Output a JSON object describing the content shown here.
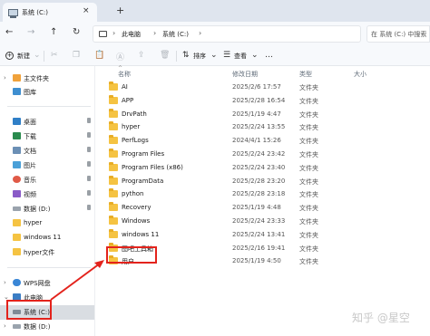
{
  "window": {
    "tab_title": "系统 (C:)",
    "tab_close": "×",
    "tab_add": "+"
  },
  "address": {
    "crumbs": [
      "此电脑",
      "系统 (C:)"
    ],
    "search_placeholder": "在 系统 (C:) 中搜索"
  },
  "toolbar": {
    "new_label": "新建",
    "sort_label": "排序",
    "view_label": "查看"
  },
  "sidebar": {
    "top_items": [
      {
        "label": "主文件夹",
        "icon": "home-icon"
      },
      {
        "label": "图库",
        "icon": "gallery-icon"
      }
    ],
    "quick_items": [
      {
        "label": "桌面",
        "icon": "desktop-icon"
      },
      {
        "label": "下载",
        "icon": "download-icon"
      },
      {
        "label": "文档",
        "icon": "document-icon"
      },
      {
        "label": "图片",
        "icon": "pictures-icon"
      },
      {
        "label": "音乐",
        "icon": "music-icon"
      },
      {
        "label": "视频",
        "icon": "video-icon"
      },
      {
        "label": "数据 (D:)",
        "icon": "drive-icon"
      },
      {
        "label": "hyper",
        "icon": "folder-icon"
      },
      {
        "label": "windows 11",
        "icon": "folder-icon"
      },
      {
        "label": "hyper文件",
        "icon": "folder-icon"
      }
    ],
    "tree_items": [
      {
        "label": "WPS网盘",
        "icon": "cloud-icon"
      },
      {
        "label": "此电脑",
        "icon": "pc-icon"
      },
      {
        "label": "系统 (C:)",
        "icon": "drive-icon"
      },
      {
        "label": "数据 (D:)",
        "icon": "drive-icon"
      }
    ]
  },
  "columns": {
    "name": "名称",
    "modified": "修改日期",
    "type": "类型",
    "size": "大小"
  },
  "files": [
    {
      "name": "AI",
      "date": "2025/2/6 17:57",
      "type": "文件夹"
    },
    {
      "name": "APP",
      "date": "2025/2/28 16:54",
      "type": "文件夹"
    },
    {
      "name": "DrvPath",
      "date": "2025/1/19 4:47",
      "type": "文件夹"
    },
    {
      "name": "hyper",
      "date": "2025/2/24 13:55",
      "type": "文件夹"
    },
    {
      "name": "PerfLogs",
      "date": "2024/4/1 15:26",
      "type": "文件夹"
    },
    {
      "name": "Program Files",
      "date": "2025/2/24 23:42",
      "type": "文件夹"
    },
    {
      "name": "Program Files (x86)",
      "date": "2025/2/24 23:40",
      "type": "文件夹"
    },
    {
      "name": "ProgramData",
      "date": "2025/2/28 23:20",
      "type": "文件夹"
    },
    {
      "name": "python",
      "date": "2025/2/28 23:18",
      "type": "文件夹"
    },
    {
      "name": "Recovery",
      "date": "2025/1/19 4:48",
      "type": "文件夹"
    },
    {
      "name": "Windows",
      "date": "2025/2/24 23:33",
      "type": "文件夹"
    },
    {
      "name": "windows 11",
      "date": "2025/2/24 13:41",
      "type": "文件夹"
    },
    {
      "name": "图吧工具箱",
      "date": "2025/2/16 19:41",
      "type": "文件夹"
    },
    {
      "name": "用户",
      "date": "2025/1/19 4:50",
      "type": "文件夹"
    }
  ],
  "watermark": "知乎 @星空",
  "colors": {
    "highlight": "#e3231c",
    "folder": "#f5c342",
    "selected_bg": "#d9dde2"
  }
}
